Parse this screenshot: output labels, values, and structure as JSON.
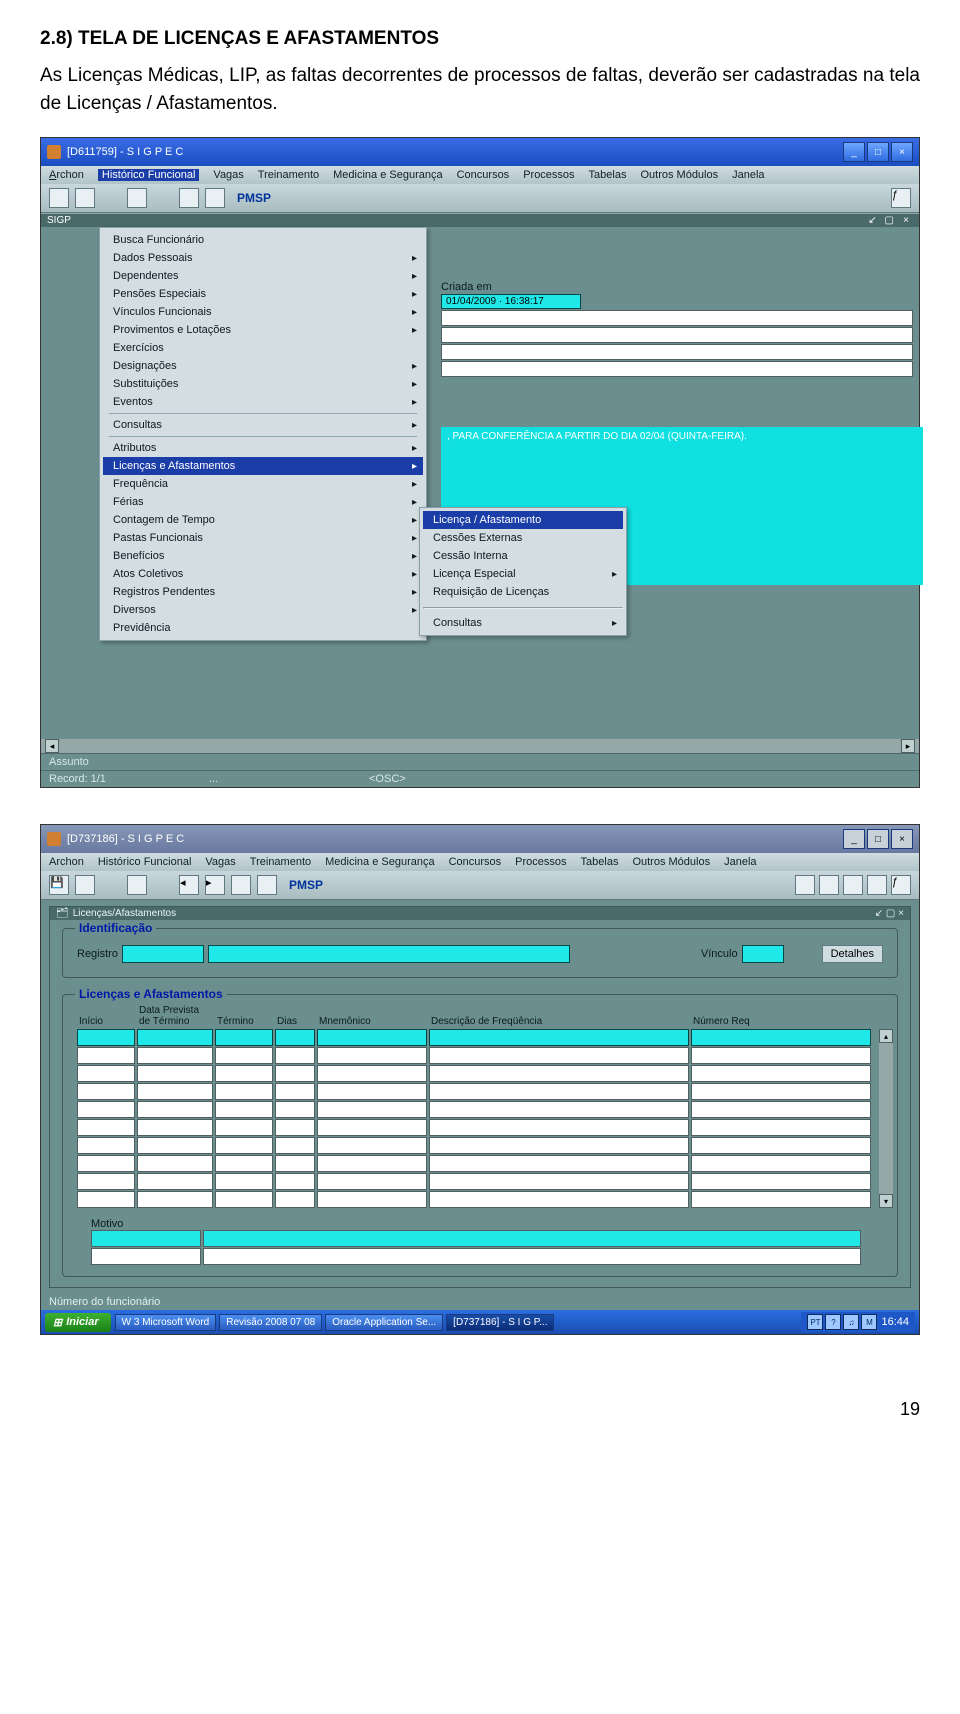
{
  "doc": {
    "section_title": "2.8) TELA DE LICENÇAS E AFASTAMENTOS",
    "section_text": "As Licenças Médicas, LIP, as faltas decorrentes de processos de faltas, deverão ser cadastradas na tela de Licenças / Afastamentos.",
    "page_number": "19"
  },
  "shared": {
    "menus": {
      "archon": "Archon",
      "historico": "Histórico Funcional",
      "vagas": "Vagas",
      "treinamento": "Treinamento",
      "medicina": "Medicina e Segurança",
      "concursos": "Concursos",
      "processos": "Processos",
      "tabelas": "Tabelas",
      "outros": "Outros Módulos",
      "janela": "Janela"
    },
    "pmsp": "PMSP"
  },
  "s1": {
    "title": "[D611759] - S I G P E C",
    "sigp_label": "SIGP",
    "criada_em_label": "Criada em",
    "criada_em_value": "01/04/2009 · 16:38:17",
    "cyan_note": ", PARA CONFERÊNCIA A PARTIR DO DIA 02/04 (QUINTA-FEIRA).",
    "menu_items": [
      {
        "label": "Busca Funcionário",
        "arrow": false
      },
      {
        "label": "Dados Pessoais",
        "arrow": true
      },
      {
        "label": "Dependentes",
        "arrow": true
      },
      {
        "label": "Pensões Especiais",
        "arrow": true
      },
      {
        "label": "Vínculos Funcionais",
        "arrow": true
      },
      {
        "label": "Provimentos e Lotações",
        "arrow": true
      },
      {
        "label": "Exercícios",
        "arrow": false
      },
      {
        "label": "Designações",
        "arrow": true
      },
      {
        "label": "Substituições",
        "arrow": true
      },
      {
        "label": "Eventos",
        "arrow": true
      },
      {
        "sep": true
      },
      {
        "label": "Consultas",
        "arrow": true
      },
      {
        "sep": true
      },
      {
        "label": "Atributos",
        "arrow": true
      },
      {
        "label": "Licenças e Afastamentos",
        "arrow": true,
        "selected": true
      },
      {
        "label": "Frequência",
        "arrow": true
      },
      {
        "label": "Férias",
        "arrow": true
      },
      {
        "label": "Contagem de Tempo",
        "arrow": true
      },
      {
        "label": "Pastas Funcionais",
        "arrow": true
      },
      {
        "label": "Benefícios",
        "arrow": true
      },
      {
        "label": "Atos Coletivos",
        "arrow": true
      },
      {
        "label": "Registros Pendentes",
        "arrow": true
      },
      {
        "label": "Diversos",
        "arrow": true
      },
      {
        "label": "Previdência",
        "arrow": false
      }
    ],
    "submenu_items": [
      {
        "label": "Licença / Afastamento",
        "selected": true
      },
      {
        "label": "Cessões Externas"
      },
      {
        "label": "Cessão Interna"
      },
      {
        "label": "Licença Especial",
        "arrow": true
      },
      {
        "label": "Requisição de Licenças"
      },
      {
        "sep": true
      },
      {
        "label": "Consultas",
        "arrow": true
      }
    ],
    "status": {
      "assunto": "Assunto",
      "record": "Record: 1/1",
      "mid": "...",
      "osc": "<OSC>"
    }
  },
  "s2": {
    "title": "[D737186] - S I G P E C",
    "inner_title": "Licenças/Afastamentos",
    "ident": {
      "group": "Identificação",
      "registro": "Registro",
      "vinculo": "Vínculo",
      "detalhes": "Detalhes"
    },
    "lic": {
      "group": "Licenças e Afastamentos",
      "cols": {
        "inicio": "Início",
        "data_prev_1": "Data Prevista",
        "data_prev_2": "de Término",
        "termino": "Término",
        "dias": "Dias",
        "mnemonico": "Mnemônico",
        "descricao": "Descrição de Freqüência",
        "numero": "Número Req"
      },
      "motivo": "Motivo"
    },
    "bottom_status": "Número do funcionário",
    "taskbar": {
      "start": "Iniciar",
      "tasks": [
        "3 Microsoft Word",
        "Revisão 2008 07 08",
        "Oracle Application Se...",
        "[D737186] - S I G P..."
      ],
      "time": "16:44",
      "tray_icons": [
        "PT",
        "?",
        "♫",
        "M"
      ]
    }
  }
}
